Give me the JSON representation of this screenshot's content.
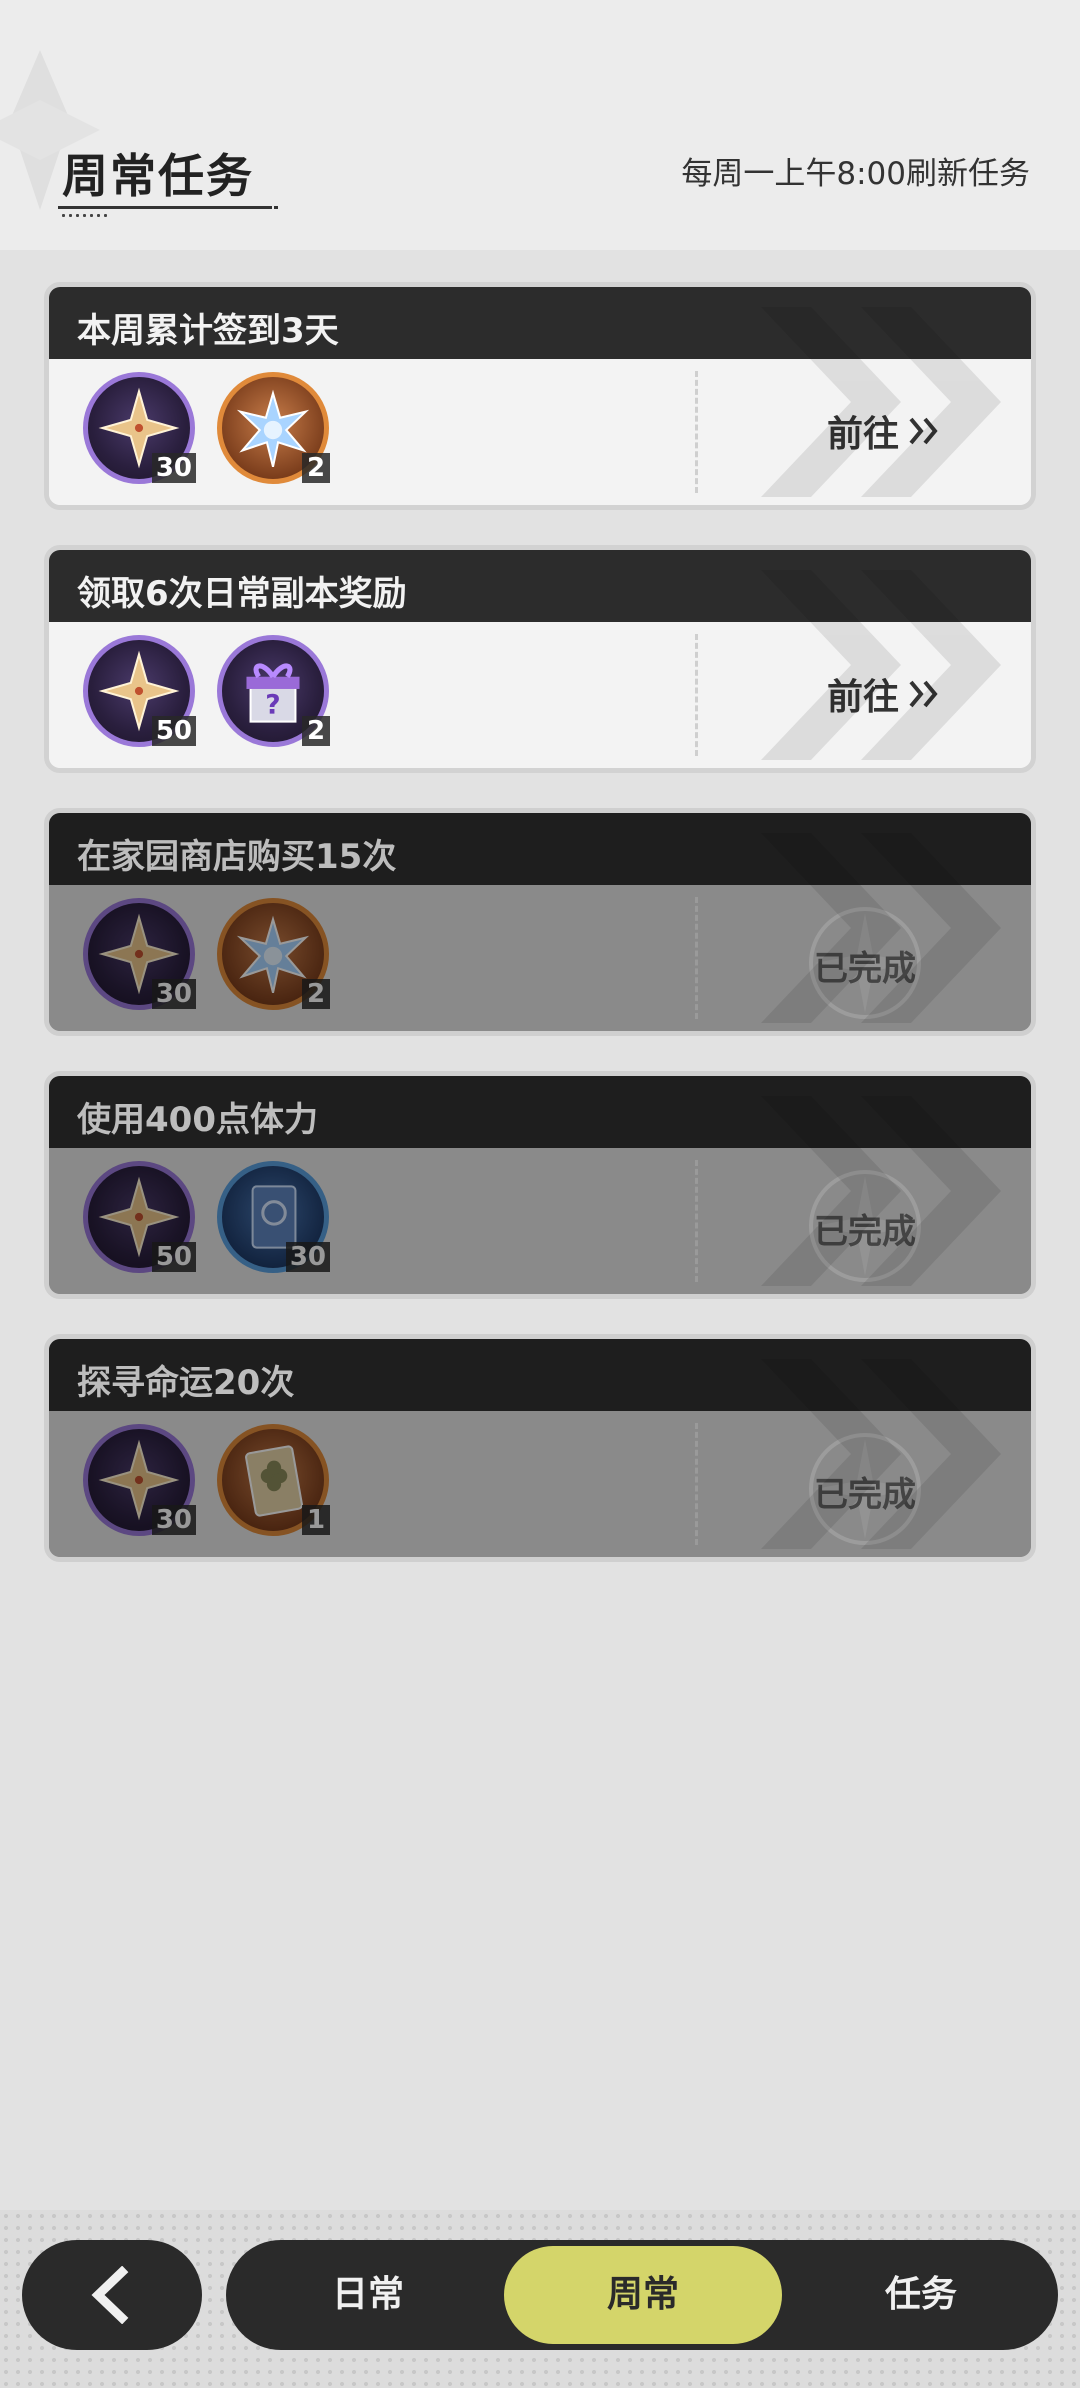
{
  "header": {
    "title": "周常任务",
    "refresh_note": "每周一上午8:00刷新任务"
  },
  "tasks": [
    {
      "title": "本周累计签到3天",
      "status": "pending",
      "action_label": "前往",
      "rewards": [
        {
          "icon": "star-shard-icon",
          "frame": "purple",
          "count": "30"
        },
        {
          "icon": "crystal-burst-icon",
          "frame": "orange",
          "count": "2"
        }
      ]
    },
    {
      "title": "领取6次日常副本奖励",
      "status": "pending",
      "action_label": "前往",
      "rewards": [
        {
          "icon": "star-shard-icon",
          "frame": "purple",
          "count": "50"
        },
        {
          "icon": "mystery-gift-icon",
          "frame": "purple",
          "count": "2"
        }
      ]
    },
    {
      "title": "在家园商店购买15次",
      "status": "done",
      "action_label": "已完成",
      "rewards": [
        {
          "icon": "star-shard-icon",
          "frame": "purple",
          "count": "30"
        },
        {
          "icon": "crystal-burst-icon",
          "frame": "orange",
          "count": "2"
        }
      ]
    },
    {
      "title": "使用400点体力",
      "status": "done",
      "action_label": "已完成",
      "rewards": [
        {
          "icon": "star-shard-icon",
          "frame": "purple",
          "count": "50"
        },
        {
          "icon": "blue-book-icon",
          "frame": "blue",
          "count": "30"
        }
      ]
    },
    {
      "title": "探寻命运20次",
      "status": "done",
      "action_label": "已完成",
      "rewards": [
        {
          "icon": "star-shard-icon",
          "frame": "purple",
          "count": "30"
        },
        {
          "icon": "clover-card-icon",
          "frame": "orange",
          "count": "1"
        }
      ]
    }
  ],
  "nav": {
    "back_icon": "chevron-left-icon",
    "tabs": [
      {
        "label": "日常",
        "active": false
      },
      {
        "label": "周常",
        "active": true
      },
      {
        "label": "任务",
        "active": false
      }
    ]
  },
  "colors": {
    "active_tab": "#d4d56a",
    "card_header": "#2c2c2c",
    "completed_overlay": "#8a8a8a",
    "rare_frame": "#9a78d8",
    "epic_frame": "#e08a3a",
    "blue_frame": "#5aa0e0"
  }
}
